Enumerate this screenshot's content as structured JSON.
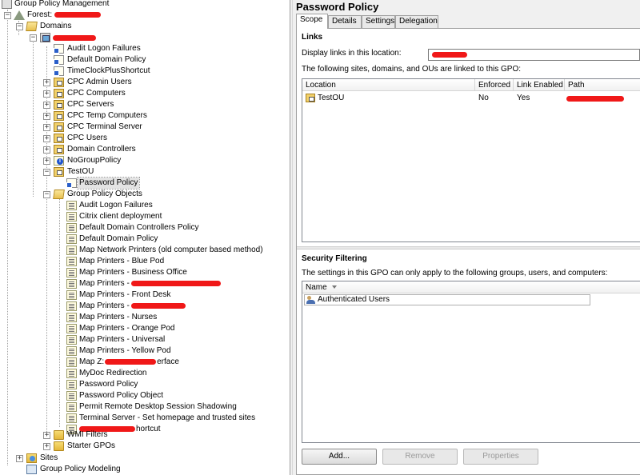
{
  "tree": {
    "root": "Group Policy Management",
    "forest_prefix": "Forest:",
    "domains": "Domains",
    "domain_links": [
      "Audit Logon Failures",
      "Default Domain Policy",
      "TimeClockPlusShortcut"
    ],
    "ous": [
      "CPC Admin Users",
      "CPC Computers",
      "CPC Servers",
      "CPC Temp Computers",
      "CPC Terminal Server",
      "CPC Users",
      "Domain Controllers",
      "NoGroupPolicy",
      "TestOU"
    ],
    "testou_link": "Password Policy",
    "gpo_container": "Group Policy Objects",
    "gpos": [
      "Audit Logon Failures",
      "Citrix client deployment",
      "Default Domain Controllers Policy",
      "Default Domain Policy",
      "Map Network Printers (old computer based method)",
      "Map Printers - Blue Pod",
      "Map Printers - Business Office",
      "Map Printers -",
      "Map Printers - Front Desk",
      "Map Printers -",
      "Map Printers - Nurses",
      "Map Printers - Orange Pod",
      "Map Printers - Universal",
      "Map Printers - Yellow Pod",
      "Map Z:",
      "MyDoc Redirection",
      "Password Policy",
      "Password Policy Object",
      "Permit Remote Desktop Session Shadowing",
      "Terminal Server - Set homepage and trusted sites",
      ""
    ],
    "gpo_suffixes": {
      "mapz": "erface",
      "last": "hortcut"
    },
    "wmi": "WMI Filters",
    "starter": "Starter GPOs",
    "sites": "Sites",
    "modeling": "Group Policy Modeling"
  },
  "panel": {
    "title": "Password Policy",
    "tabs": [
      "Scope",
      "Details",
      "Settings",
      "Delegation"
    ],
    "links_heading": "Links",
    "display_links_label": "Display links in this location:",
    "linked_text": "The following sites, domains, and OUs are linked to this GPO:",
    "links_columns": [
      "Location",
      "Enforced",
      "Link Enabled",
      "Path"
    ],
    "links_rows": [
      {
        "location": "TestOU",
        "enforced": "No",
        "link_enabled": "Yes"
      }
    ],
    "security_heading": "Security Filtering",
    "security_text": "The settings in this GPO can only apply to the following groups, users, and computers:",
    "security_column": "Name",
    "security_rows": [
      "Authenticated Users"
    ],
    "buttons": [
      "Add...",
      "Remove",
      "Properties"
    ]
  },
  "colors": {
    "redaction": "#f01818",
    "window_bg": "#f0f0f0"
  }
}
